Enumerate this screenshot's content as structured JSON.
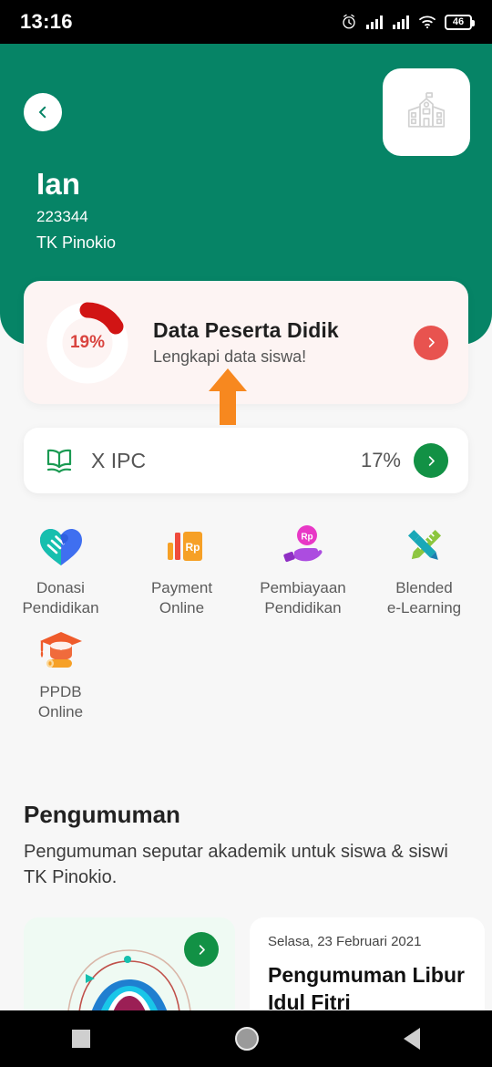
{
  "statusbar": {
    "time": "13:16",
    "battery_level": "46",
    "icons": [
      "alarm-icon",
      "signal-icon",
      "signal-icon",
      "wifi-icon",
      "battery-icon"
    ]
  },
  "header": {
    "back_icon": "chevron-left-icon",
    "school_logo_icon": "school-building-icon",
    "user_name": "Ian",
    "user_id": "223344",
    "school_name": "TK Pinokio",
    "background_color": "#068466"
  },
  "data_card": {
    "progress_percent": "19%",
    "title": "Data Peserta Didik",
    "subtitle": "Lengkapi data siswa!",
    "arrow_icon": "chevron-right-icon",
    "accent_color": "#e8534f",
    "background_color": "#fdf4f3"
  },
  "annotation": {
    "arrow_icon": "up-arrow-annotation",
    "color": "#f7881f"
  },
  "class_card": {
    "icon": "open-book-icon",
    "name": "X IPC",
    "percent": "17%",
    "arrow_icon": "chevron-right-icon",
    "accent_color": "#129145"
  },
  "menu": {
    "items": [
      {
        "icon": "heart-handshake-icon",
        "line1": "Donasi",
        "line2": "Pendidikan"
      },
      {
        "icon": "payment-card-rp-icon",
        "line1": "Payment",
        "line2": "Online"
      },
      {
        "icon": "hand-coin-rp-icon",
        "line1": "Pembiayaan",
        "line2": "Pendidikan"
      },
      {
        "icon": "pencil-ruler-icon",
        "line1": "Blended",
        "line2": "e-Learning"
      },
      {
        "icon": "graduation-cap-diploma-icon",
        "line1": "PPDB",
        "line2": "Online"
      }
    ]
  },
  "announcement": {
    "section_title": "Pengumuman",
    "section_desc": "Pengumuman seputar akademik untuk siswa & siswi TK Pinokio.",
    "illustration_card": {
      "icon": "abstract-illustration",
      "arrow_icon": "chevron-right-icon"
    },
    "text_card": {
      "date": "Selasa, 23 Februari 2021",
      "title": "Pengumuman Libur Idul Fitri"
    }
  },
  "navbar": {
    "recents_icon": "square-recents-icon",
    "home_icon": "circle-home-icon",
    "back_icon": "triangle-back-icon"
  }
}
